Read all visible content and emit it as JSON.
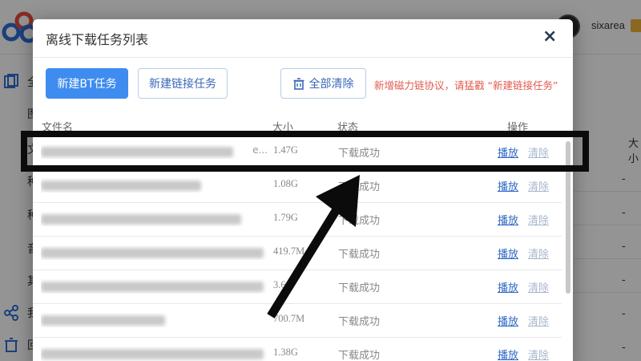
{
  "background": {
    "username": "sixarea",
    "sidebar_labels": [
      "全",
      "图",
      "文",
      "种",
      "种",
      "音",
      "其",
      "我",
      "回"
    ],
    "right_header": "大小",
    "right_values": [
      "-",
      "-",
      "-",
      "-",
      "-",
      "-"
    ]
  },
  "modal": {
    "title": "离线下载任务列表",
    "close_label": "×",
    "buttons": {
      "new_bt": "新建BT任务",
      "new_link": "新建链接任务",
      "clear_all": "全部清除"
    },
    "notice": "新增磁力链协议，请猛戳 “新建链接任务”",
    "columns": {
      "name": "文件名",
      "size": "大小",
      "status": "状态",
      "ops": "操作"
    },
    "rows": [
      {
        "name_tail": "e...",
        "size": "1.47G",
        "status": "下载成功",
        "play": "播放",
        "clear": "清除"
      },
      {
        "name_tail": "",
        "size": "1.08G",
        "status": "下载成功",
        "play": "播放",
        "clear": "清除"
      },
      {
        "name_tail": "",
        "size": "1.79G",
        "status": "下载成功",
        "play": "播放",
        "clear": "清除"
      },
      {
        "name_tail": "",
        "size": "419.7M",
        "status": "下载成功",
        "play": "播放",
        "clear": "清除"
      },
      {
        "name_tail": "",
        "size": "3.6G",
        "status": "下载成功",
        "play": "播放",
        "clear": "清除"
      },
      {
        "name_tail": "",
        "size": "700.7M",
        "status": "下载成功",
        "play": "播放",
        "clear": "清除"
      },
      {
        "name_tail": "",
        "size": "1.38G",
        "status": "下载成功",
        "play": "播放",
        "clear": "清除"
      }
    ]
  },
  "colors": {
    "primary": "#3f8cf0",
    "notice": "#e05a4f",
    "link": "#2f68c4",
    "muted_link": "#a7b6cc",
    "annotation": "#0b0b0b"
  }
}
